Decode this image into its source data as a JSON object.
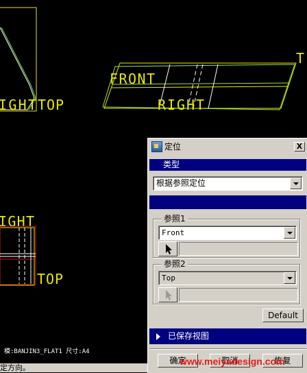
{
  "canvas": {
    "labels": {
      "ight_top_upper": "IGHT",
      "top_upper": "TOP",
      "front": "FRONT",
      "right_mid": "RIGHT",
      "t_edge": "T",
      "ight_lower": "IGHT",
      "top_lower": "TOP"
    }
  },
  "dialog": {
    "title": "定位",
    "close_label": "X",
    "type_header": "类型",
    "type_value": "根据参照定位",
    "ref1": {
      "label": "参照1",
      "value": "Front"
    },
    "ref2": {
      "label": "参照2",
      "value": "Top"
    },
    "default_button": "Default",
    "saved_views_label": "已保存视图",
    "ok_button": "确定",
    "cancel_button": "取消",
    "restore_button": "恢复"
  },
  "status": {
    "model_info": "模:BANJIN3_FLAT1  尺寸:A4",
    "message": "定方向。"
  },
  "watermark": "www.meiyadesign.com",
  "colors": {
    "title_bar_blue": "#000080",
    "face": "#d4d0c8",
    "cad_yellow": "#ffff00",
    "cad_green": "#9ae64a"
  }
}
